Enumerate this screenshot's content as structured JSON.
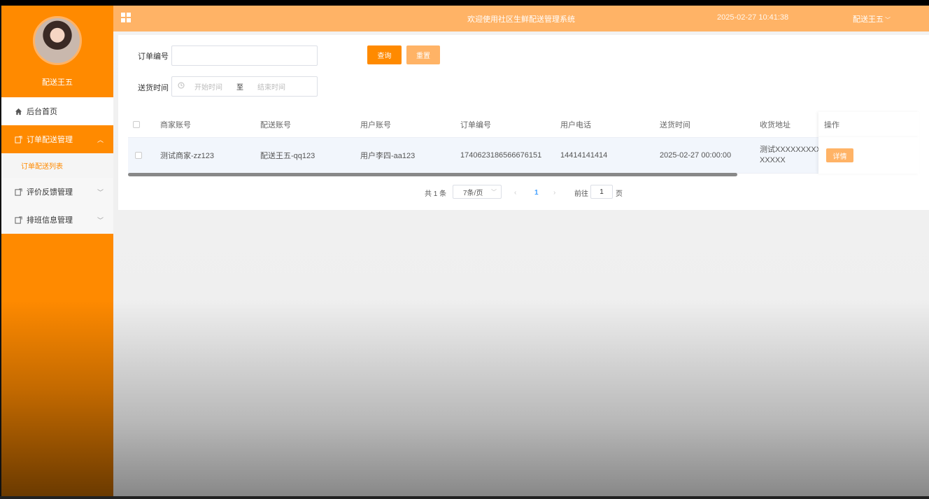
{
  "sidebar": {
    "username": "配送王五",
    "menu": [
      {
        "label": "后台首页",
        "icon": "home-icon"
      },
      {
        "label": "订单配送管理",
        "icon": "edit-icon",
        "sub": [
          "订单配送列表"
        ]
      },
      {
        "label": "评价反馈管理",
        "icon": "edit-icon"
      },
      {
        "label": "排班信息管理",
        "icon": "edit-icon"
      }
    ]
  },
  "topbar": {
    "title": "欢迎使用社区生鲜配送管理系统",
    "datetime": "2025-02-27 10:41:38",
    "user": "配送王五"
  },
  "search": {
    "order_label": "订单编号",
    "order_value": "",
    "time_label": "送货时间",
    "start_placeholder": "开始时间",
    "range_sep": "至",
    "end_placeholder": "结束时间",
    "query_btn": "查询",
    "reset_btn": "重置"
  },
  "table": {
    "headers": [
      "商家账号",
      "配送账号",
      "用户账号",
      "订单编号",
      "用户电话",
      "送货时间",
      "收货地址",
      "操作"
    ],
    "rows": [
      {
        "merchant": "测试商家-zz123",
        "courier": "配送王五-qq123",
        "user": "用户李四-aa123",
        "order_no": "1740623186566676151",
        "phone": "14414141414",
        "delivery_time": "2025-02-27 00:00:00",
        "address_line1": "测试XXXXXXXXXX",
        "address_line2": "XXXXX",
        "action": "详情"
      }
    ]
  },
  "pagination": {
    "total": "共 1 条",
    "page_size": "7条/页",
    "current_page": "1",
    "goto_label": "前往",
    "goto_value": "1",
    "page_unit": "页"
  }
}
